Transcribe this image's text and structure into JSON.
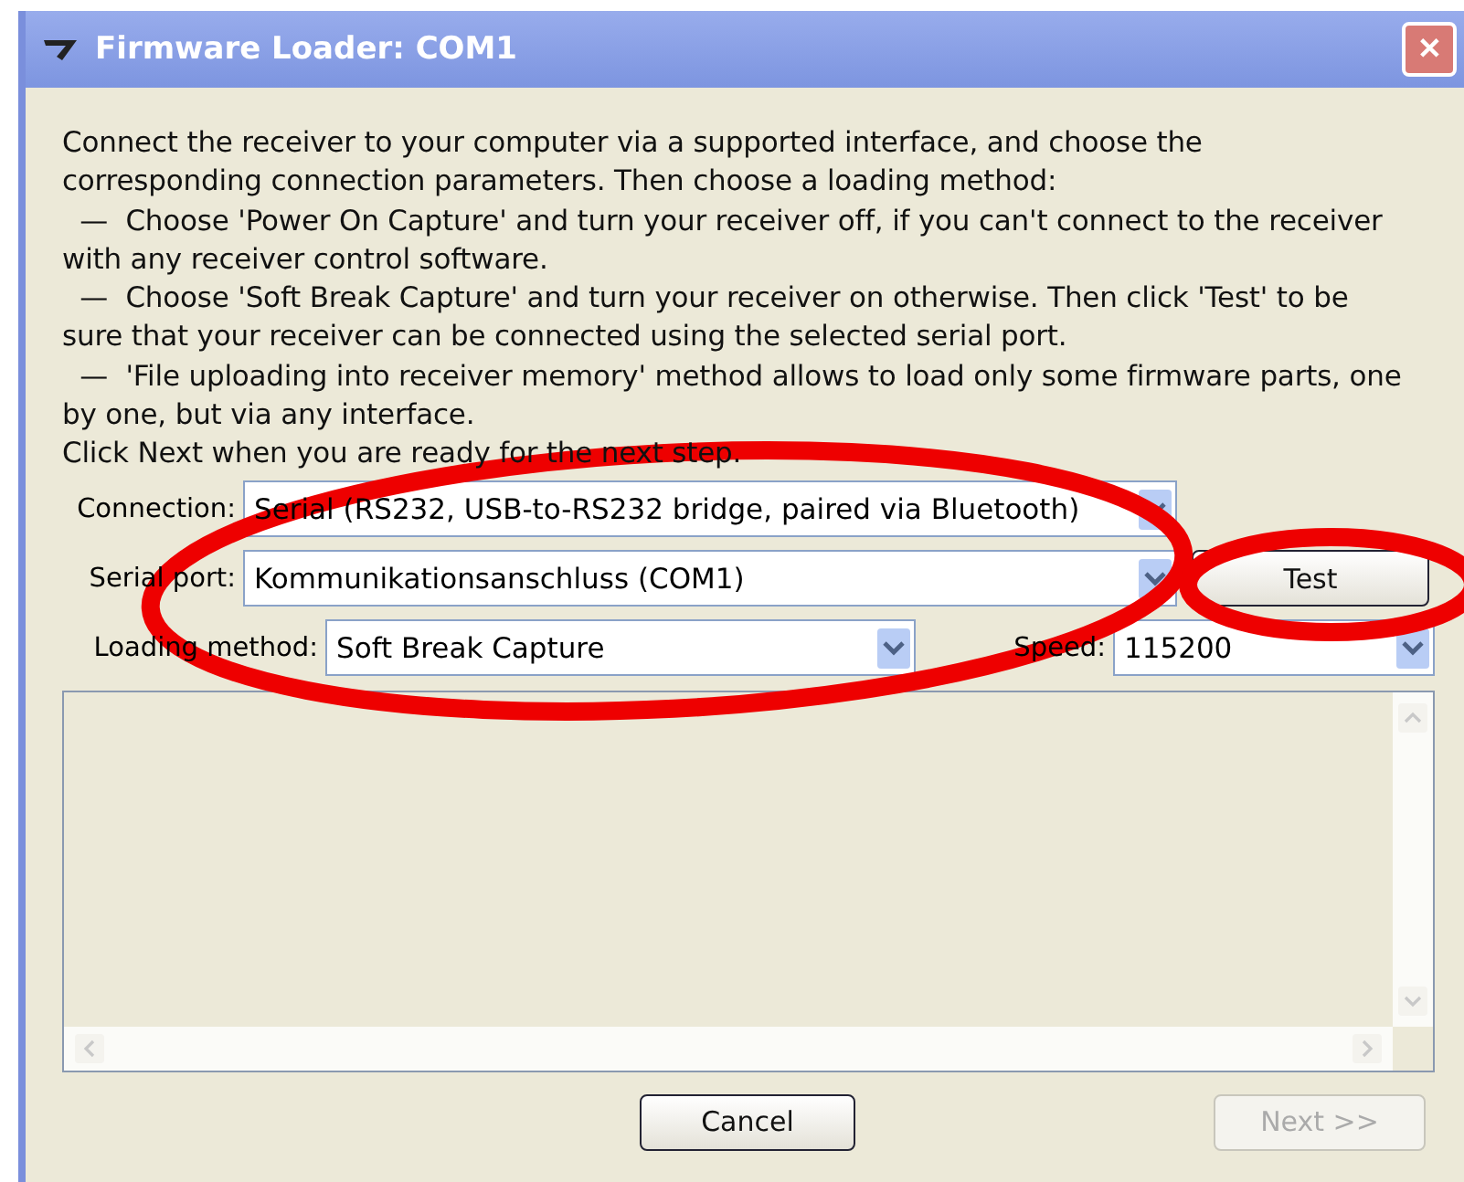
{
  "window": {
    "title": "Firmware Loader: COM1",
    "close": "✕"
  },
  "instructions": [
    "Connect the receiver to your computer via a supported interface, and choose the",
    "corresponding connection parameters. Then choose a loading method:",
    "  —  Choose 'Power On Capture' and turn your receiver off, if you can't connect to the receiver",
    "with any receiver control software.",
    "  —  Choose 'Soft Break Capture' and turn your receiver on otherwise. Then click 'Test' to be",
    "sure that your receiver can be connected using the selected serial port.",
    "  —  'File uploading into receiver memory' method allows to load only some firmware parts, one",
    "by one, but via any interface.",
    "Click Next when you are ready for the next step."
  ],
  "connection": {
    "label": "Connection:",
    "value": "Serial (RS232, USB-to-RS232 bridge, paired via Bluetooth)"
  },
  "serial_port": {
    "label": "Serial port:",
    "value": "Kommunikationsanschluss (COM1)"
  },
  "test_button": {
    "label": "Test",
    "disabled": false
  },
  "loading_method": {
    "label": "Loading method:",
    "value": "Soft Break Capture"
  },
  "speed": {
    "label": "Speed:",
    "value": "115200"
  },
  "buttons": [
    {
      "label": "Cancel",
      "disabled": false
    },
    {
      "label": "Next >>",
      "disabled": true
    }
  ],
  "annotations": [
    {
      "kind": "ellipse"
    },
    {
      "kind": "ellipse"
    }
  ]
}
